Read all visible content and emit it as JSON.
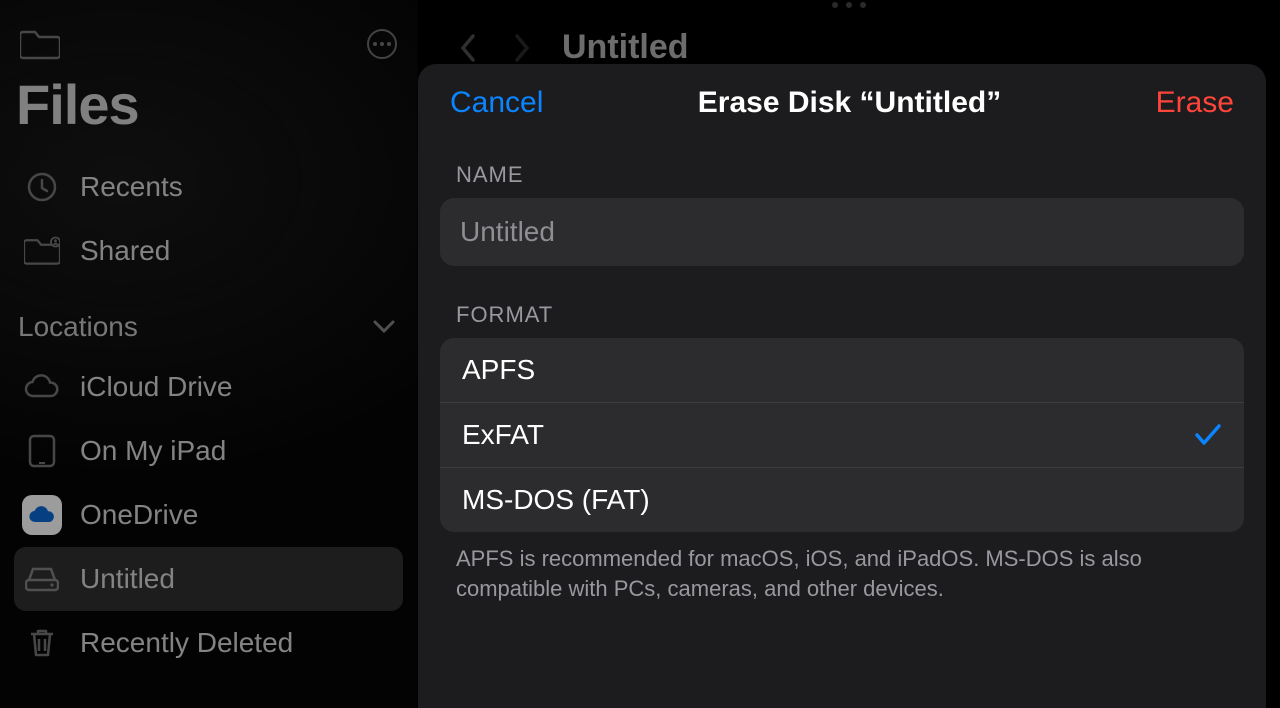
{
  "sidebar": {
    "app_title": "Files",
    "recents": "Recents",
    "shared": "Shared",
    "locations_label": "Locations",
    "icloud": "iCloud Drive",
    "on_my_ipad": "On My iPad",
    "onedrive": "OneDrive",
    "untitled": "Untitled",
    "recently_deleted": "Recently Deleted"
  },
  "content": {
    "title": "Untitled"
  },
  "modal": {
    "cancel": "Cancel",
    "title": "Erase Disk “Untitled”",
    "erase": "Erase",
    "name_label": "NAME",
    "name_placeholder": "Untitled",
    "name_value": "",
    "format_label": "FORMAT",
    "formats": {
      "apfs": "APFS",
      "exfat": "ExFAT",
      "msdos": "MS-DOS (FAT)"
    },
    "selected_format": "exfat",
    "format_note": "APFS is recommended for macOS, iOS, and iPadOS. MS-DOS is also compatible with PCs, cameras, and other devices."
  }
}
